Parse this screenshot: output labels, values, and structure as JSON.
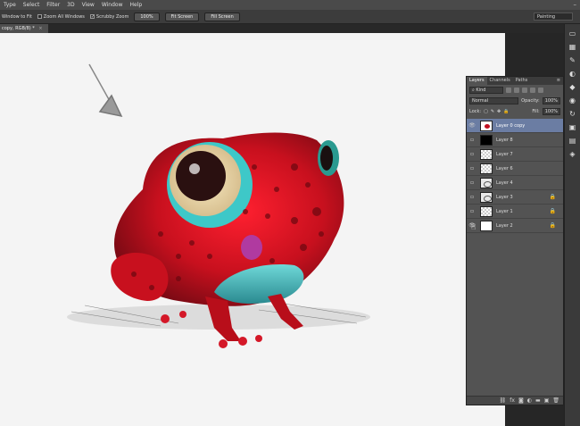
{
  "menu": [
    "Type",
    "Select",
    "Filter",
    "3D",
    "View",
    "Window",
    "Help"
  ],
  "options": {
    "window_to_fit": "Window to Fit",
    "zoom_all_windows": "Zoom All Windows",
    "scrubby_zoom": "Scrubby Zoom",
    "zoom_value": "100%",
    "fit_screen": "Fit Screen",
    "fill_screen": "Fill Screen",
    "workspace": "Painting"
  },
  "document_tab": {
    "title": "copy, RGB/8) *"
  },
  "layers_panel": {
    "tabs": [
      "Layers",
      "Channels",
      "Paths"
    ],
    "kind_label": "Kind",
    "blend_mode": "Normal",
    "opacity_label": "Opacity:",
    "opacity_value": "100%",
    "lock_label": "Lock:",
    "fill_label": "Fill:",
    "fill_value": "100%",
    "layers": [
      {
        "name": "Layer 0 copy",
        "thumb": "frog",
        "visible": true,
        "selected": true,
        "locked": false
      },
      {
        "name": "Layer 8",
        "thumb": "black",
        "visible": false,
        "selected": false,
        "locked": false
      },
      {
        "name": "Layer 7",
        "thumb": "checker",
        "visible": false,
        "selected": false,
        "locked": false
      },
      {
        "name": "Layer 6",
        "thumb": "checker",
        "visible": false,
        "selected": false,
        "locked": false
      },
      {
        "name": "Layer 4",
        "thumb": "sketch",
        "visible": false,
        "selected": false,
        "locked": false
      },
      {
        "name": "Layer 3",
        "thumb": "sketch",
        "visible": false,
        "selected": false,
        "locked": true
      },
      {
        "name": "Layer 1",
        "thumb": "checker",
        "visible": false,
        "selected": false,
        "locked": true
      },
      {
        "name": "Layer 2",
        "thumb": "white",
        "visible": true,
        "selected": false,
        "locked": true
      }
    ]
  },
  "colors": {
    "frog_red": "#c8101e",
    "selected_layer": "#6b7da3"
  }
}
